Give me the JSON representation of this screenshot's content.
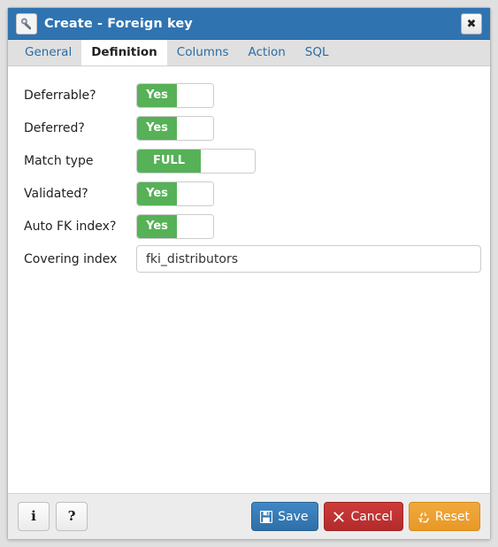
{
  "window": {
    "title": "Create - Foreign key",
    "icon": "key-icon",
    "close_label": "✖",
    "titlebar_color": "#3073b1"
  },
  "tabs": [
    {
      "label": "General",
      "active": false
    },
    {
      "label": "Definition",
      "active": true
    },
    {
      "label": "Columns",
      "active": false
    },
    {
      "label": "Action",
      "active": false
    },
    {
      "label": "SQL",
      "active": false
    }
  ],
  "form": {
    "fields": [
      {
        "label": "Deferrable?",
        "type": "toggle",
        "value": "Yes",
        "width": "narrow"
      },
      {
        "label": "Deferred?",
        "type": "toggle",
        "value": "Yes",
        "width": "narrow"
      },
      {
        "label": "Match type",
        "type": "toggle",
        "value": "FULL",
        "width": "wide"
      },
      {
        "label": "Validated?",
        "type": "toggle",
        "value": "Yes",
        "width": "narrow"
      },
      {
        "label": "Auto FK index?",
        "type": "toggle",
        "value": "Yes",
        "width": "narrow"
      }
    ],
    "covering_index": {
      "label": "Covering index",
      "value": "fki_distributors",
      "placeholder": ""
    },
    "toggle_on_color": "#56b157"
  },
  "footer": {
    "info_label": "i",
    "help_label": "?",
    "save_label": "Save",
    "cancel_label": "Cancel",
    "reset_label": "Reset",
    "save_color": "#3f88c5",
    "cancel_color": "#ce3b3b",
    "reset_color": "#f0a93e"
  }
}
